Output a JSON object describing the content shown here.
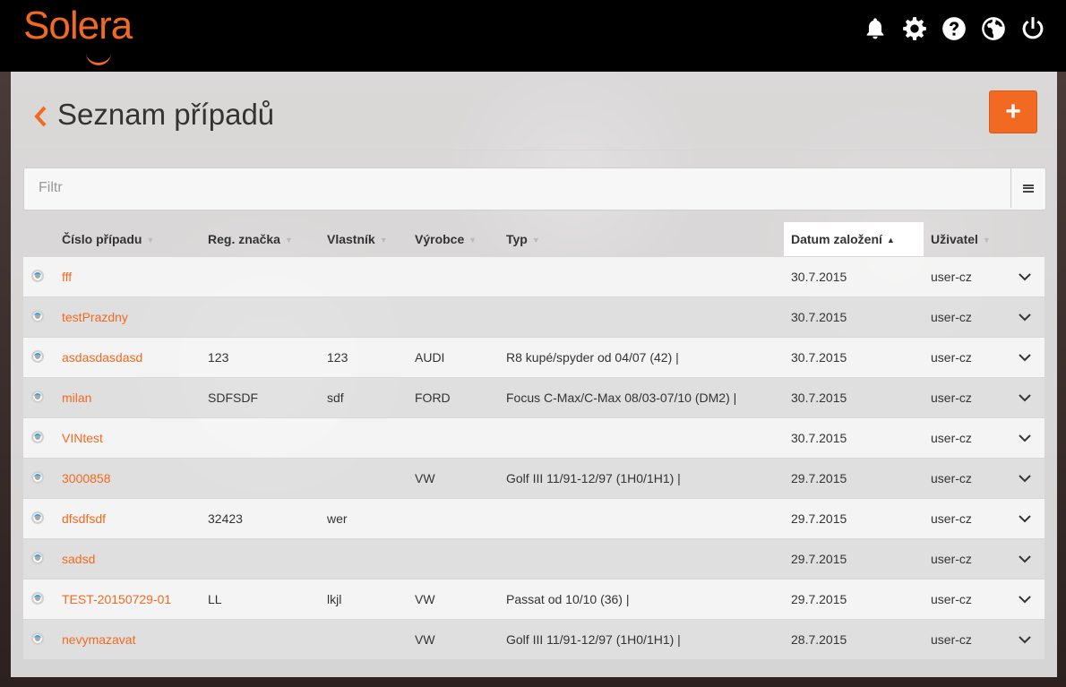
{
  "app": {
    "logo": "Solera"
  },
  "topbar": {
    "icons": [
      "bell-icon",
      "gear-icon",
      "help-icon",
      "globe-icon",
      "power-icon"
    ]
  },
  "page": {
    "title": "Seznam případů",
    "add_label": "+"
  },
  "filter": {
    "placeholder": "Filtr",
    "value": ""
  },
  "table": {
    "columns": [
      {
        "key": "cislo",
        "label": "Číslo případu"
      },
      {
        "key": "reg",
        "label": "Reg. značka"
      },
      {
        "key": "vlastnik",
        "label": "Vlastník"
      },
      {
        "key": "vyrobce",
        "label": "Výrobce"
      },
      {
        "key": "typ",
        "label": "Typ"
      },
      {
        "key": "datum",
        "label": "Datum založení"
      },
      {
        "key": "uzivatel",
        "label": "Uživatel"
      }
    ],
    "sort": {
      "column": "datum",
      "direction": "asc"
    },
    "rows": [
      {
        "cislo": "fff",
        "reg": "",
        "vlastnik": "",
        "vyrobce": "",
        "typ": "",
        "datum": "30.7.2015",
        "uzivatel": "user-cz"
      },
      {
        "cislo": "testPrazdny",
        "reg": "",
        "vlastnik": "",
        "vyrobce": "",
        "typ": "",
        "datum": "30.7.2015",
        "uzivatel": "user-cz"
      },
      {
        "cislo": "asdasdasdasd",
        "reg": "123",
        "vlastnik": "123",
        "vyrobce": "AUDI",
        "typ": "R8 kupé/spyder od 04/07 (42) |",
        "datum": "30.7.2015",
        "uzivatel": "user-cz"
      },
      {
        "cislo": "milan",
        "reg": "SDFSDF",
        "vlastnik": "sdf",
        "vyrobce": "FORD",
        "typ": "Focus C-Max/C-Max 08/03-07/10 (DM2) |",
        "datum": "30.7.2015",
        "uzivatel": "user-cz"
      },
      {
        "cislo": "VINtest",
        "reg": "",
        "vlastnik": "",
        "vyrobce": "",
        "typ": "",
        "datum": "30.7.2015",
        "uzivatel": "user-cz"
      },
      {
        "cislo": "3000858",
        "reg": "",
        "vlastnik": "",
        "vyrobce": "VW",
        "typ": "Golf III 11/91-12/97 (1H0/1H1) |",
        "datum": "29.7.2015",
        "uzivatel": "user-cz"
      },
      {
        "cislo": "dfsdfsdf",
        "reg": "32423",
        "vlastnik": "wer",
        "vyrobce": "",
        "typ": "",
        "datum": "29.7.2015",
        "uzivatel": "user-cz"
      },
      {
        "cislo": "sadsd",
        "reg": "",
        "vlastnik": "",
        "vyrobce": "",
        "typ": "",
        "datum": "29.7.2015",
        "uzivatel": "user-cz"
      },
      {
        "cislo": "TEST-20150729-01",
        "reg": "LL",
        "vlastnik": "lkjl",
        "vyrobce": "VW",
        "typ": "Passat od 10/10 (36) |",
        "datum": "29.7.2015",
        "uzivatel": "user-cz"
      },
      {
        "cislo": "nevymazavat",
        "reg": "",
        "vlastnik": "",
        "vyrobce": "VW",
        "typ": "Golf III 11/91-12/97 (1H0/1H1) |",
        "datum": "28.7.2015",
        "uzivatel": "user-cz"
      }
    ]
  },
  "colors": {
    "accent": "#f26a21",
    "status": "#3aa0d8"
  }
}
